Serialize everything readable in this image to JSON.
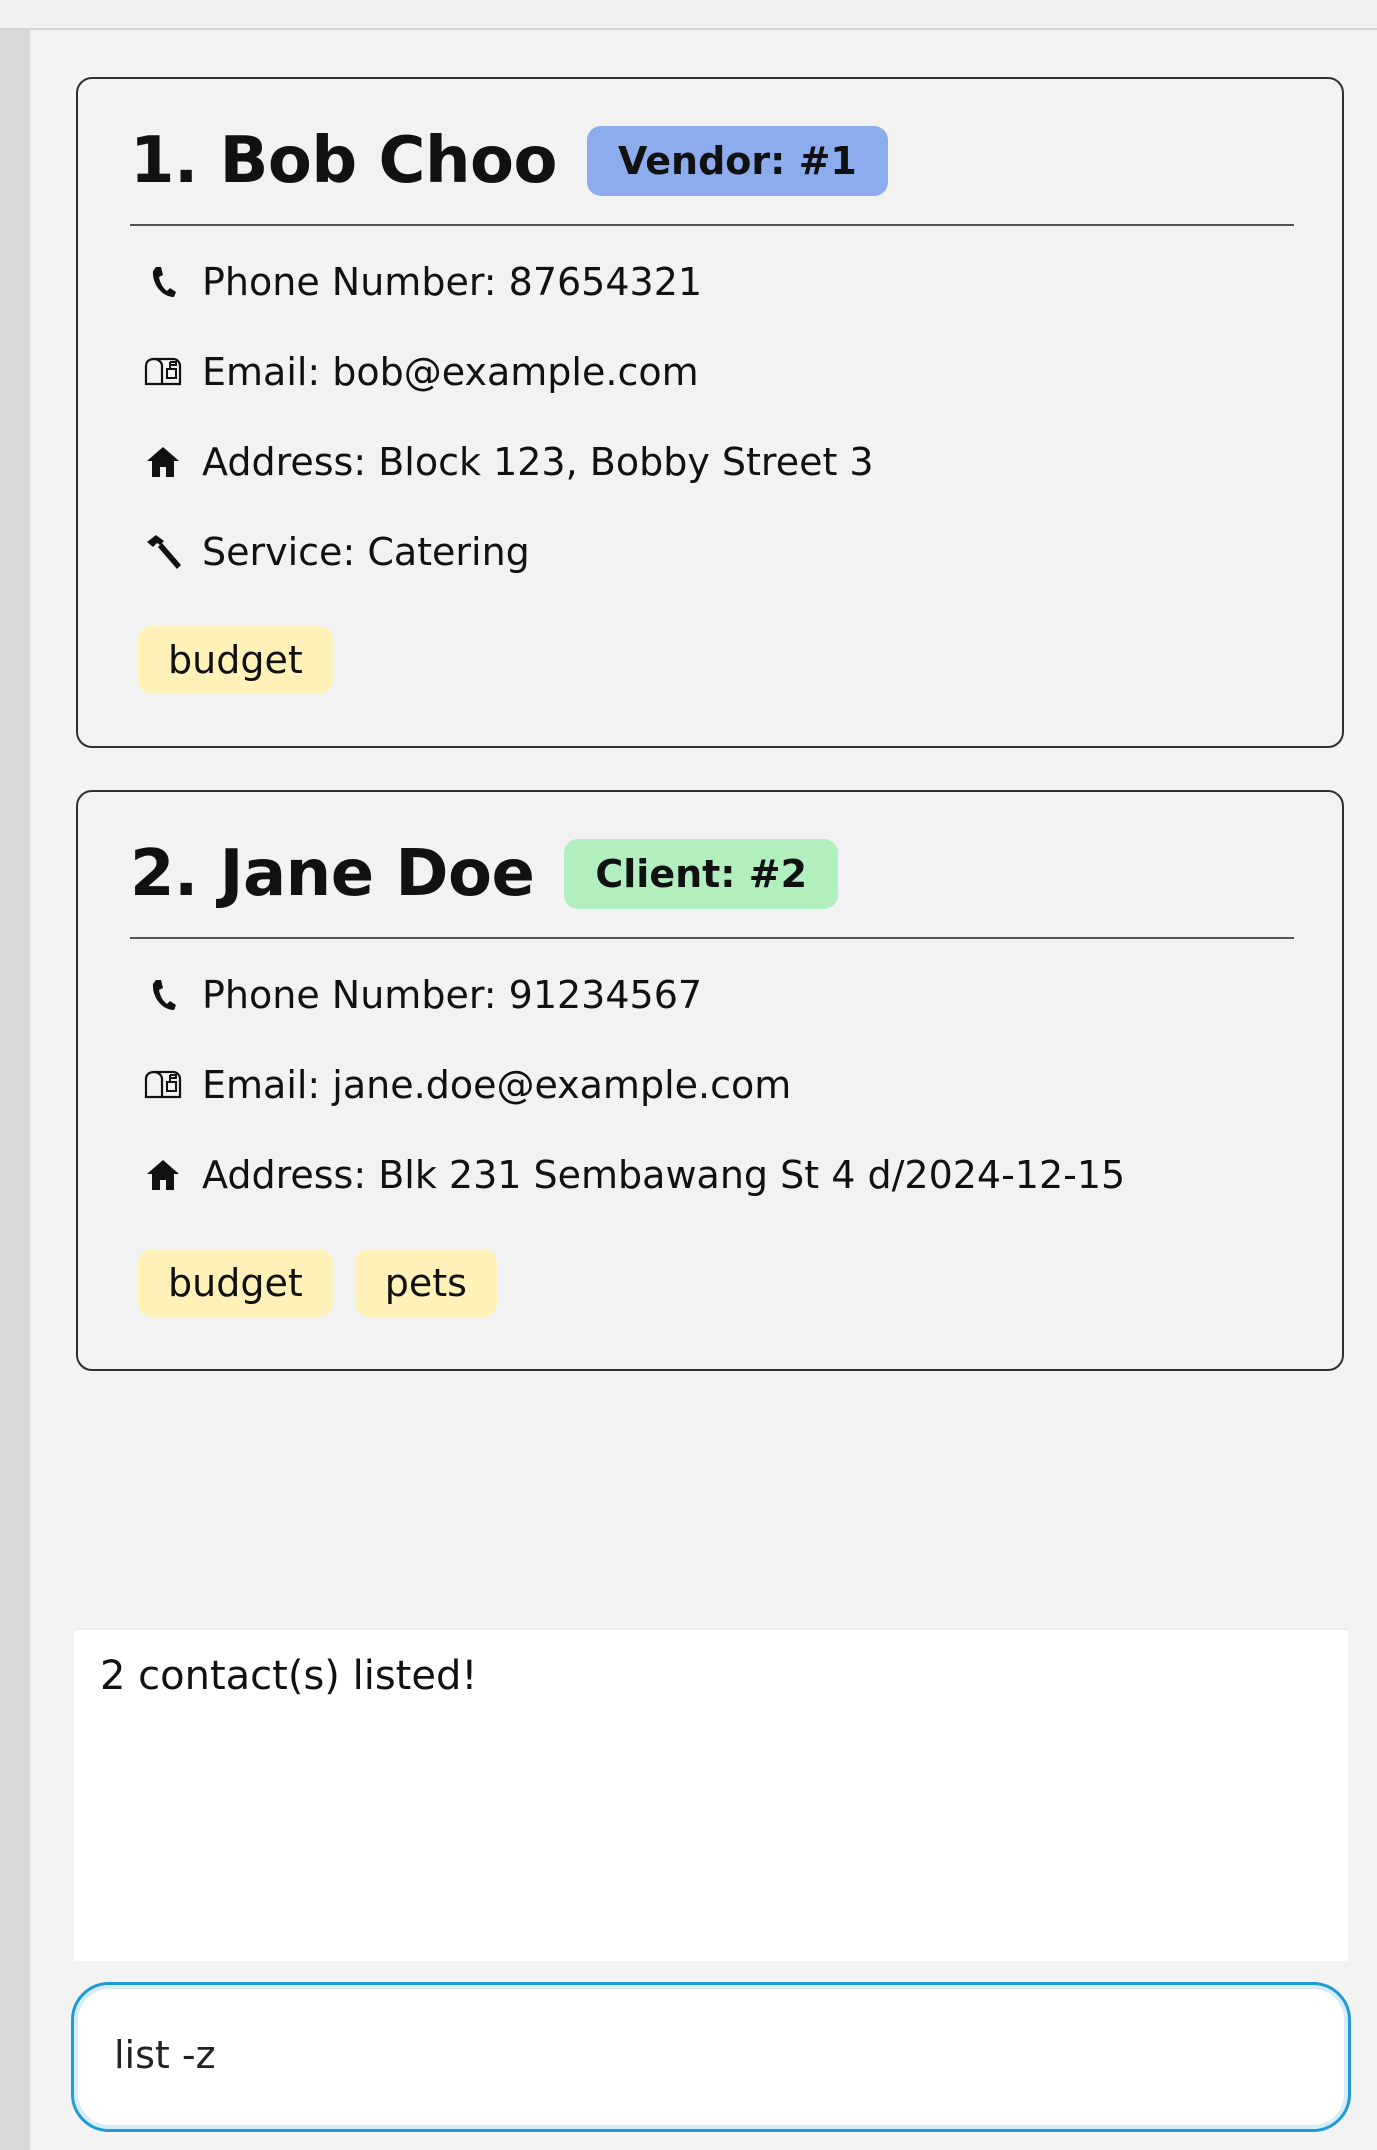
{
  "contacts": [
    {
      "name": "1. Bob Choo",
      "badge": "Vendor: #1",
      "phone": "Phone Number: 87654321",
      "email": "Email: bob@example.com",
      "address": "Address: Block 123, Bobby Street 3",
      "service": "Service: Catering",
      "tags": [
        "budget"
      ]
    },
    {
      "name": "2. Jane Doe",
      "badge": "Client: #2",
      "phone": "Phone Number: 91234567",
      "email": "Email: jane.doe@example.com",
      "address": "Address: Blk 231 Sembawang St 4 d/2024-12-15",
      "tags": [
        "budget",
        "pets"
      ]
    }
  ],
  "result": {
    "message": "2 contact(s) listed!"
  },
  "command": {
    "value": "list -z"
  },
  "icons": {
    "phone": "phone-icon",
    "email": "mailbox-icon",
    "address": "house-icon",
    "service": "hammer-icon"
  },
  "colors": {
    "vendor_badge": "#8cacee",
    "client_badge": "#b2efbf",
    "tag": "#fff1b8",
    "command_border": "#1e9ad6"
  }
}
